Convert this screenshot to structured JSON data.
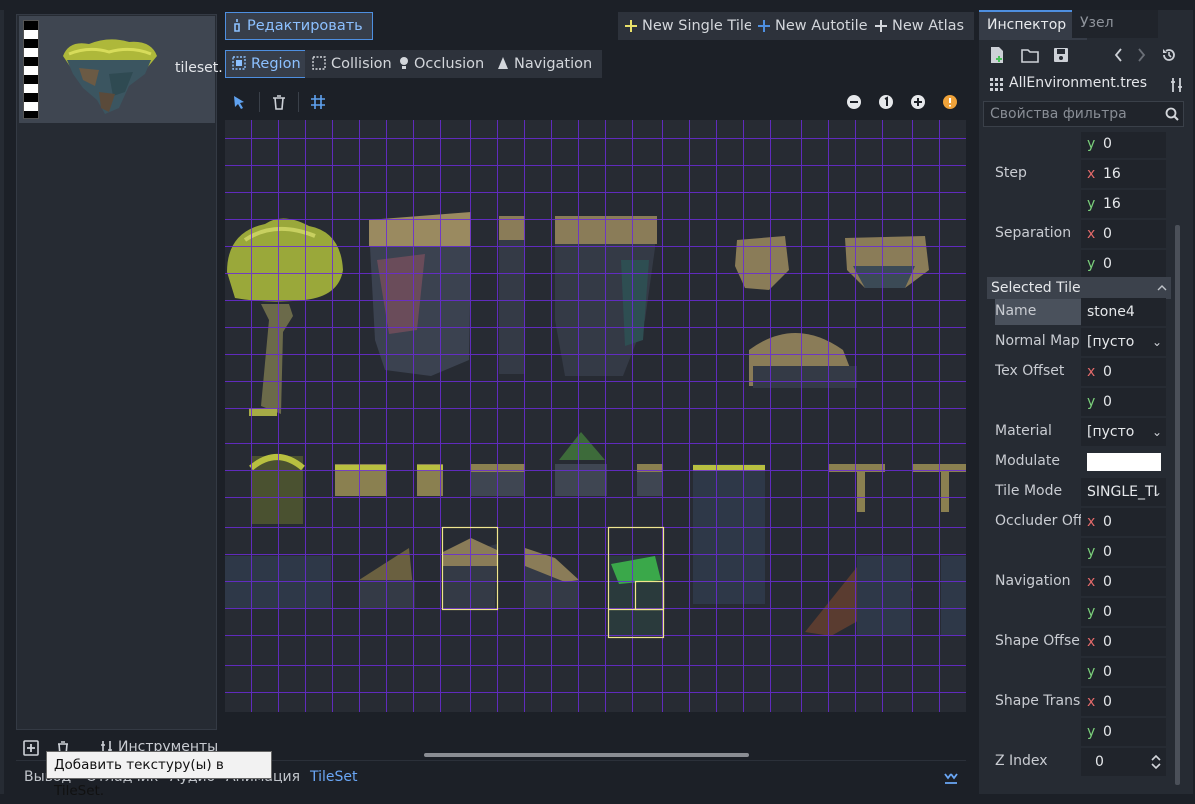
{
  "texture_list": {
    "item_label": "tileset.",
    "tools": {
      "manage_label": "Инструменты"
    },
    "tooltip": "Добавить текстуру(ы) в TileSet."
  },
  "bottom_tabs": [
    "Вывод",
    "Отладчик",
    "Аудио",
    "Анимация",
    "TileSet"
  ],
  "editor": {
    "edit_button": "Редактировать",
    "new_single_tile": "New Single Tile",
    "new_autotile": "New Autotile",
    "new_atlas": "New Atlas",
    "modes": [
      "Region",
      "Collision",
      "Occlusion",
      "Navigation"
    ],
    "selected_mode": "Region"
  },
  "inspector": {
    "tabs": [
      "Инспектор",
      "Узел"
    ],
    "resource_name": "AllEnvironment.tres",
    "filter_placeholder": "Свойства фильтра",
    "section_title": "Selected Tile",
    "props": {
      "offset_y": "0",
      "step_label": "Step",
      "step_x": "16",
      "step_y": "16",
      "separation_label": "Separation",
      "separation_x": "0",
      "separation_y": "0",
      "name_label": "Name",
      "name_value": "stone4",
      "normal_map_label": "Normal Map",
      "normal_map_value": "[пусто",
      "tex_offset_label": "Tex Offset",
      "tex_offset_x": "0",
      "tex_offset_y": "0",
      "material_label": "Material",
      "material_value": "[пусто",
      "modulate_label": "Modulate",
      "modulate_color": "#ffffff",
      "tile_mode_label": "Tile Mode",
      "tile_mode_value": "SINGLE_TI",
      "occluder_label": "Occluder Off",
      "occluder_x": "0",
      "occluder_y": "0",
      "navigation_label": "Navigation",
      "navigation_x": "0",
      "navigation_y": "0",
      "shape_offset_label": "Shape Offse",
      "shape_offset_x": "0",
      "shape_offset_y": "0",
      "shape_trans_label": "Shape Trans",
      "shape_trans_x": "0",
      "shape_trans_y": "0",
      "z_index_label": "Z Index",
      "z_index_value": "0"
    }
  },
  "colors": {
    "accent": "#4e8fe0",
    "grid": "#6a2bd6",
    "selection": "#f0e68c"
  }
}
